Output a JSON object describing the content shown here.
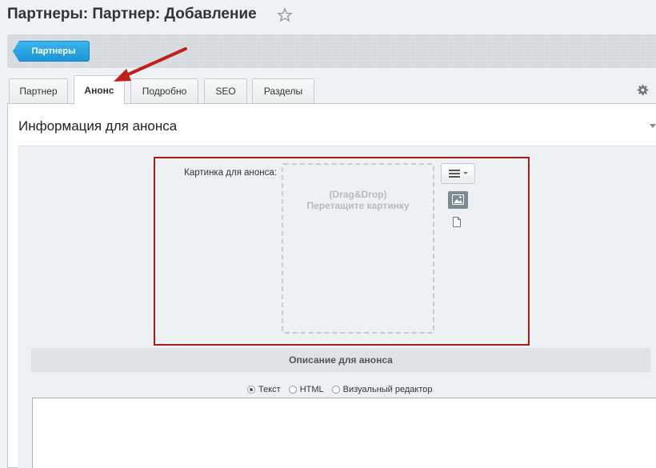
{
  "header": {
    "title": "Партнеры: Партнер: Добавление"
  },
  "toolbar": {
    "back_label": "Партнеры"
  },
  "tabs": [
    {
      "label": "Партнер"
    },
    {
      "label": "Анонс"
    },
    {
      "label": "Подробно"
    },
    {
      "label": "SEO"
    },
    {
      "label": "Разделы"
    }
  ],
  "active_tab": "Анонс",
  "section": {
    "title": "Информация для анонса"
  },
  "picture_field": {
    "label": "Картинка для анонса:",
    "drop_line1": "(Drag&Drop)",
    "drop_line2": "Перетащите картинку"
  },
  "description": {
    "title": "Описание для анонса",
    "options": [
      "Текст",
      "HTML",
      "Визуальный редактор"
    ],
    "selected": "Текст",
    "value": ""
  },
  "colors": {
    "accent": "#1c96d8",
    "highlight": "#a81b1b",
    "arrow": "#c0201c"
  },
  "icons": [
    "star-icon",
    "gear-icon",
    "menu-icon",
    "image-icon",
    "file-icon",
    "arrow-annotation"
  ]
}
